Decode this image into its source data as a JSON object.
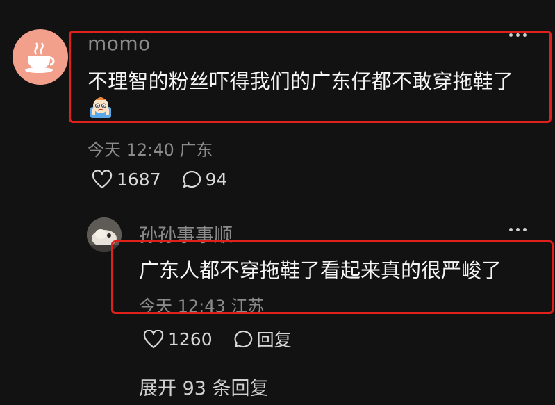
{
  "comment": {
    "username": "momo",
    "text": "不理智的粉丝吓得我们的广东仔都不敢穿拖鞋了",
    "emoji": "crying-face-emoji",
    "time": "今天 12:40",
    "location": "广东",
    "likes": "1687",
    "replies": "94"
  },
  "reply": {
    "username": "孙孙事事顺",
    "text": "广东人都不穿拖鞋了看起来真的很严峻了",
    "time": "今天 12:43",
    "location": "江苏",
    "likes": "1260",
    "reply_label": "回复"
  },
  "expand_label": "展开 93 条回复",
  "colors": {
    "background": "#121212",
    "highlight_border": "#e0201a",
    "muted_text": "#8b8b8b",
    "avatar_main": "#f2a08c"
  },
  "icons": {
    "more": "more-icon",
    "like": "heart-icon",
    "comment": "comment-bubble-icon"
  }
}
